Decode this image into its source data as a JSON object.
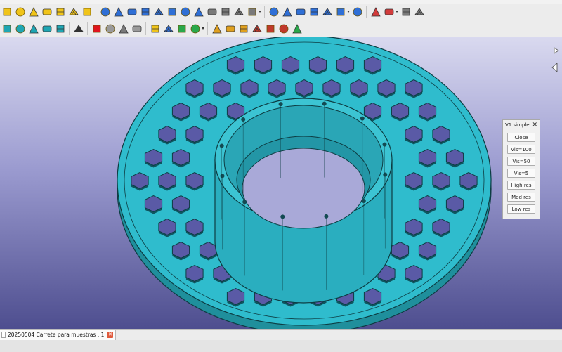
{
  "window": {
    "document_name": "20250504 Carrete para muestras : 1"
  },
  "toolbar_row1": [
    {
      "name": "cube-icon",
      "color": "#f0c419"
    },
    {
      "name": "sphere-icon",
      "color": "#f0c419"
    },
    {
      "name": "cone-icon",
      "color": "#f0c419"
    },
    {
      "name": "torus-icon",
      "color": "#f0c419"
    },
    {
      "name": "cylinder-icon",
      "color": "#f0c419"
    },
    {
      "name": "primitives-icon",
      "color": "#f0c419"
    },
    {
      "name": "shape-builder-icon",
      "color": "#f0c419"
    },
    {
      "name": "extrude-icon",
      "color": "#2f6fd6"
    },
    {
      "name": "revolve-icon",
      "color": "#2f6fd6"
    },
    {
      "name": "mirror-icon",
      "color": "#2f6fd6"
    },
    {
      "name": "fillet-icon",
      "color": "#2f6fd6"
    },
    {
      "name": "chamfer-icon",
      "color": "#2f6fd6"
    },
    {
      "name": "make-face-icon",
      "color": "#2f6fd6"
    },
    {
      "name": "ruled-surface-icon",
      "color": "#2f6fd6"
    },
    {
      "name": "loft-icon",
      "color": "#2f6fd6"
    },
    {
      "name": "sweep-icon",
      "color": "#7a7a7a"
    },
    {
      "name": "section-icon",
      "color": "#7a7a7a"
    },
    {
      "name": "cross-sections-icon",
      "color": "#7a7a7a"
    },
    {
      "name": "offset-icon",
      "color": "#7a7a7a"
    },
    {
      "name": "thickness-icon",
      "color": "#2f6fd6"
    },
    {
      "name": "projection-icon",
      "color": "#2f6fd6"
    },
    {
      "name": "boolean-icon",
      "color": "#2f6fd6"
    },
    {
      "name": "cut-icon",
      "color": "#2f6fd6"
    },
    {
      "name": "fuse-icon",
      "color": "#2f6fd6"
    },
    {
      "name": "common-icon",
      "color": "#2f6fd6"
    },
    {
      "name": "join-icon",
      "color": "#2f6fd6"
    },
    {
      "name": "split-icon",
      "color": "#d23b3b"
    },
    {
      "name": "compound-icon",
      "color": "#d23b3b"
    },
    {
      "name": "check-geometry-icon",
      "color": "#7a7a7a"
    },
    {
      "name": "defeaturing-icon",
      "color": "#7a7a7a"
    }
  ],
  "toolbar_row2": [
    {
      "name": "view-front-icon",
      "color": "#1ea6b3"
    },
    {
      "name": "view-top-icon",
      "color": "#1ea6b3"
    },
    {
      "name": "view-right-icon",
      "color": "#1ea6b3"
    },
    {
      "name": "view-rear-icon",
      "color": "#1ea6b3"
    },
    {
      "name": "measure-icon",
      "color": "#1ea6b3"
    },
    {
      "name": "whats-this-icon",
      "color": "#333333"
    },
    {
      "name": "record-macro-icon",
      "color": "#e0141e"
    },
    {
      "name": "stop-macro-icon",
      "color": "#9a9a9a"
    },
    {
      "name": "macros-icon",
      "color": "#7a7a7a"
    },
    {
      "name": "execute-macro-icon",
      "color": "#9a9a9a"
    },
    {
      "name": "part-icon",
      "color": "#f0c419"
    },
    {
      "name": "group-icon",
      "color": "#2f6fd6"
    },
    {
      "name": "link-icon",
      "color": "#2aa84a"
    },
    {
      "name": "link-actions-icon",
      "color": "#2aa84a"
    },
    {
      "name": "std-tool-1-icon",
      "color": "#e0a01e"
    },
    {
      "name": "std-tool-2-icon",
      "color": "#e0a01e"
    },
    {
      "name": "std-tool-3-icon",
      "color": "#e0a01e"
    },
    {
      "name": "std-tool-4-icon",
      "color": "#c0392b"
    },
    {
      "name": "std-tool-5-icon",
      "color": "#c0392b"
    },
    {
      "name": "std-tool-6-icon",
      "color": "#c0392b"
    },
    {
      "name": "std-tool-7-icon",
      "color": "#2aa84a"
    }
  ],
  "macro_panel": {
    "title": "V1 simple",
    "buttons": [
      "Close",
      "Vis=100",
      "Vis=50",
      "Vis=5",
      "High res",
      "Med res",
      "Low res"
    ]
  },
  "model": {
    "color": "#2fbccd",
    "edge_color": "#0d3c42"
  }
}
